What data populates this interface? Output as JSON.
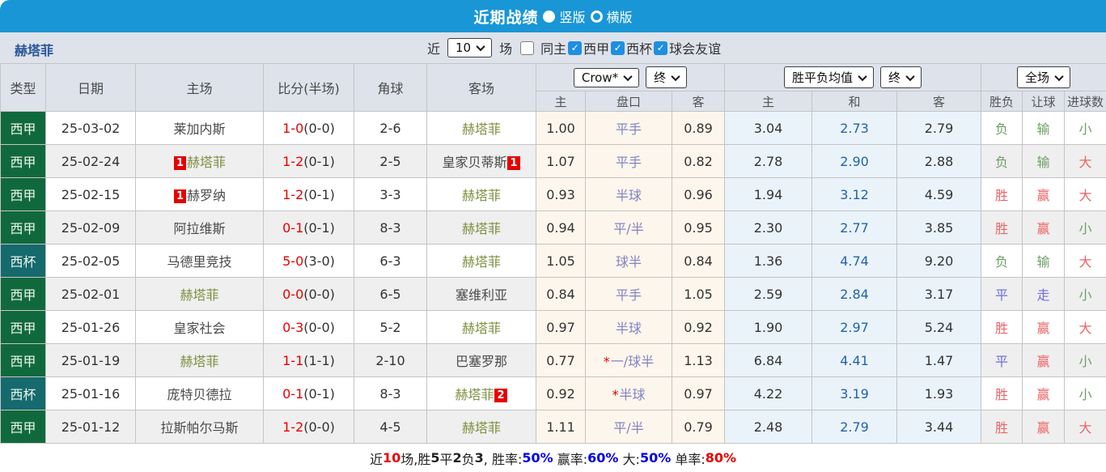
{
  "titlebar": {
    "title": "近期战绩",
    "radio_vertical": "竖版",
    "radio_horizontal": "横版"
  },
  "filter": {
    "team": "赫塔菲",
    "recent_label": "近",
    "recent_value": "10",
    "games_label": "场",
    "toggles": [
      {
        "label": "同主",
        "checked": false
      },
      {
        "label": "西甲",
        "checked": true
      },
      {
        "label": "西杯",
        "checked": true
      },
      {
        "label": "球会友谊",
        "checked": true
      }
    ]
  },
  "table": {
    "cols": [
      "类型",
      "日期",
      "主场",
      "比分(半场)",
      "角球",
      "客场"
    ],
    "subcols": [
      "主",
      "盘口",
      "客",
      "主",
      "和",
      "客",
      "胜负",
      "让球",
      "进球数"
    ],
    "selects": {
      "crow_company": "Crow*",
      "crow_period": "终",
      "avg_company": "胜平负均值",
      "avg_period": "终",
      "scope": "全场"
    },
    "rows": [
      {
        "league": "西甲",
        "league_type": "liga",
        "date": "25-03-02",
        "home": "莱加内斯",
        "home_focus": false,
        "home_card": null,
        "score": "1-0",
        "half": "(0-0)",
        "corners": "2-6",
        "away": "赫塔菲",
        "away_focus": true,
        "away_card": null,
        "crow": [
          "1.00",
          "平手",
          "0.89"
        ],
        "handicap_star": false,
        "avg": [
          "3.04",
          "2.73",
          "2.79"
        ],
        "results": [
          "负",
          "输",
          "小"
        ]
      },
      {
        "league": "西甲",
        "league_type": "liga",
        "date": "25-02-24",
        "home": "赫塔菲",
        "home_focus": true,
        "home_card": "1",
        "score": "1-2",
        "half": "(0-1)",
        "corners": "2-5",
        "away": "皇家贝蒂斯",
        "away_focus": false,
        "away_card": "1",
        "crow": [
          "1.07",
          "平手",
          "0.82"
        ],
        "handicap_star": false,
        "avg": [
          "2.78",
          "2.90",
          "2.88"
        ],
        "results": [
          "负",
          "输",
          "大"
        ]
      },
      {
        "league": "西甲",
        "league_type": "liga",
        "date": "25-02-15",
        "home": "赫罗纳",
        "home_focus": false,
        "home_card": "1",
        "score": "1-2",
        "half": "(0-1)",
        "corners": "3-3",
        "away": "赫塔菲",
        "away_focus": true,
        "away_card": null,
        "crow": [
          "0.93",
          "半球",
          "0.96"
        ],
        "handicap_star": false,
        "avg": [
          "1.94",
          "3.12",
          "4.59"
        ],
        "results": [
          "胜",
          "赢",
          "大"
        ]
      },
      {
        "league": "西甲",
        "league_type": "liga",
        "date": "25-02-09",
        "home": "阿拉维斯",
        "home_focus": false,
        "home_card": null,
        "score": "0-1",
        "half": "(0-1)",
        "corners": "8-3",
        "away": "赫塔菲",
        "away_focus": true,
        "away_card": null,
        "crow": [
          "0.94",
          "平/半",
          "0.95"
        ],
        "handicap_star": false,
        "avg": [
          "2.30",
          "2.77",
          "3.85"
        ],
        "results": [
          "胜",
          "赢",
          "小"
        ]
      },
      {
        "league": "西杯",
        "league_type": "cup",
        "date": "25-02-05",
        "home": "马德里竞技",
        "home_focus": false,
        "home_card": null,
        "score": "5-0",
        "half": "(3-0)",
        "corners": "6-3",
        "away": "赫塔菲",
        "away_focus": true,
        "away_card": null,
        "crow": [
          "1.05",
          "球半",
          "0.84"
        ],
        "handicap_star": false,
        "avg": [
          "1.36",
          "4.74",
          "9.20"
        ],
        "results": [
          "负",
          "输",
          "大"
        ]
      },
      {
        "league": "西甲",
        "league_type": "liga",
        "date": "25-02-01",
        "home": "赫塔菲",
        "home_focus": true,
        "home_card": null,
        "score": "0-0",
        "half": "(0-0)",
        "corners": "6-5",
        "away": "塞维利亚",
        "away_focus": false,
        "away_card": null,
        "crow": [
          "0.84",
          "平手",
          "1.05"
        ],
        "handicap_star": false,
        "avg": [
          "2.59",
          "2.84",
          "3.17"
        ],
        "results": [
          "平",
          "走",
          "小"
        ]
      },
      {
        "league": "西甲",
        "league_type": "liga",
        "date": "25-01-26",
        "home": "皇家社会",
        "home_focus": false,
        "home_card": null,
        "score": "0-3",
        "half": "(0-0)",
        "corners": "5-2",
        "away": "赫塔菲",
        "away_focus": true,
        "away_card": null,
        "crow": [
          "0.97",
          "半球",
          "0.92"
        ],
        "handicap_star": false,
        "avg": [
          "1.90",
          "2.97",
          "5.24"
        ],
        "results": [
          "胜",
          "赢",
          "大"
        ]
      },
      {
        "league": "西甲",
        "league_type": "liga",
        "date": "25-01-19",
        "home": "赫塔菲",
        "home_focus": true,
        "home_card": null,
        "score": "1-1",
        "half": "(1-1)",
        "corners": "2-10",
        "away": "巴塞罗那",
        "away_focus": false,
        "away_card": null,
        "crow": [
          "0.77",
          "一/球半",
          "1.13"
        ],
        "handicap_star": true,
        "avg": [
          "6.84",
          "4.41",
          "1.47"
        ],
        "results": [
          "平",
          "赢",
          "小"
        ]
      },
      {
        "league": "西杯",
        "league_type": "cup",
        "date": "25-01-16",
        "home": "庞特贝德拉",
        "home_focus": false,
        "home_card": null,
        "score": "0-1",
        "half": "(0-1)",
        "corners": "8-3",
        "away": "赫塔菲",
        "away_focus": true,
        "away_card": "2",
        "crow": [
          "0.92",
          "半球",
          "0.97"
        ],
        "handicap_star": true,
        "avg": [
          "4.22",
          "3.19",
          "1.93"
        ],
        "results": [
          "胜",
          "赢",
          "小"
        ]
      },
      {
        "league": "西甲",
        "league_type": "liga",
        "date": "25-01-12",
        "home": "拉斯帕尔马斯",
        "home_focus": false,
        "home_card": null,
        "score": "1-2",
        "half": "(0-0)",
        "corners": "4-5",
        "away": "赫塔菲",
        "away_focus": true,
        "away_card": null,
        "crow": [
          "1.11",
          "平/半",
          "0.79"
        ],
        "handicap_star": false,
        "avg": [
          "2.48",
          "2.79",
          "3.44"
        ],
        "results": [
          "胜",
          "赢",
          "大"
        ]
      }
    ]
  },
  "summary": {
    "segments": [
      {
        "t": "近",
        "c": "k"
      },
      {
        "t": "10",
        "c": "r"
      },
      {
        "t": "场,胜",
        "c": "k"
      },
      {
        "t": "5",
        "c": "kb"
      },
      {
        "t": "平",
        "c": "k"
      },
      {
        "t": "2",
        "c": "kb"
      },
      {
        "t": "负",
        "c": "k"
      },
      {
        "t": "3",
        "c": "kb"
      },
      {
        "t": ", 胜率:",
        "c": "k"
      },
      {
        "t": "50%",
        "c": "b"
      },
      {
        "t": " 赢率:",
        "c": "k"
      },
      {
        "t": "60%",
        "c": "b"
      },
      {
        "t": " 大:",
        "c": "k"
      },
      {
        "t": "50%",
        "c": "b"
      },
      {
        "t": " 单率:",
        "c": "k"
      },
      {
        "t": "80%",
        "c": "r"
      }
    ]
  }
}
